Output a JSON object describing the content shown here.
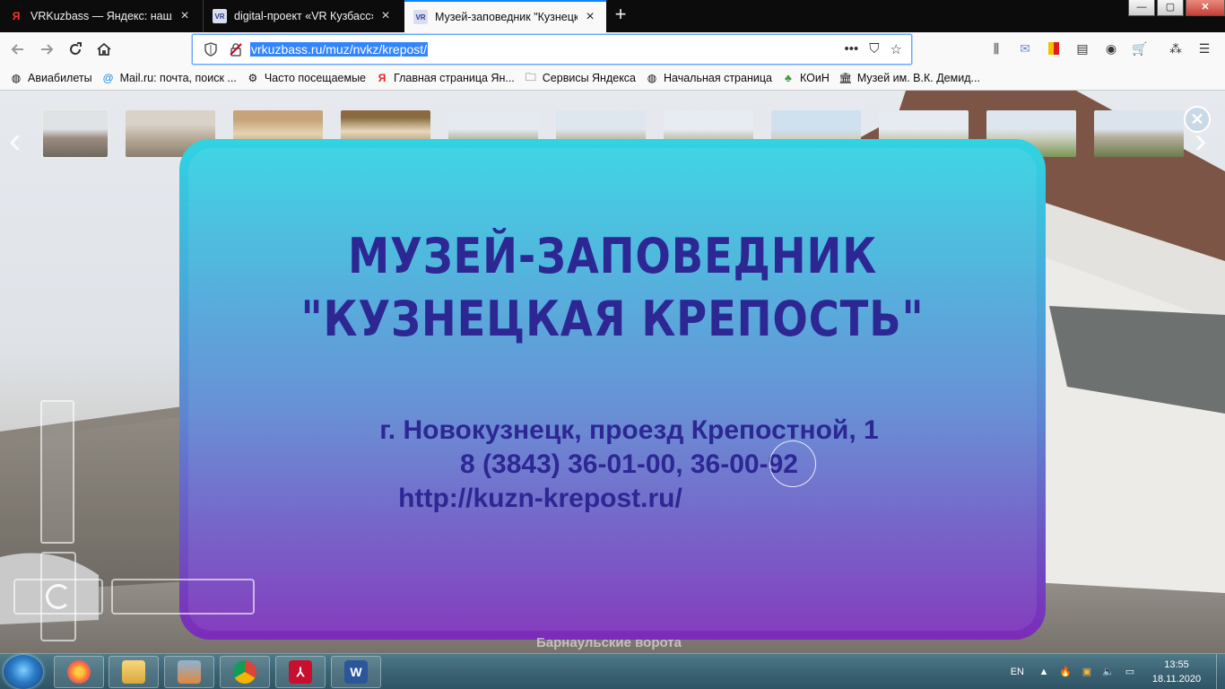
{
  "browser": {
    "tabs": [
      {
        "title": "VRKuzbass — Яндекс: нашлось",
        "favicon": "yandex-icon"
      },
      {
        "title": "digital-проект «VR Кузбасс» —",
        "favicon": "vr-kuzbass-icon"
      },
      {
        "title": "Музей-заповедник \"Кузнецка",
        "favicon": "vr-kuzbass-icon",
        "active": true
      }
    ],
    "new_tab": "+",
    "url": "vrkuzbass.ru/muz/nvkz/krepost/",
    "window_controls": {
      "minimize": "—",
      "maximize": "▢",
      "close": "✕"
    }
  },
  "bookmarks": [
    {
      "label": "Авиабилеты",
      "icon": "globe-icon"
    },
    {
      "label": "Mail.ru: почта, поиск ...",
      "icon": "mailru-icon"
    },
    {
      "label": "Часто посещаемые",
      "icon": "gear-icon"
    },
    {
      "label": "Главная страница Ян...",
      "icon": "yandex-icon"
    },
    {
      "label": "Сервисы Яндекса",
      "icon": "folder-icon"
    },
    {
      "label": "Начальная страница",
      "icon": "globe-icon"
    },
    {
      "label": "КОиН",
      "icon": "koin-icon"
    },
    {
      "label": "Музей им. В.К. Демид...",
      "icon": "museum-icon"
    }
  ],
  "pano": {
    "title_line1": "МУЗЕЙ-ЗАПОВЕДНИК",
    "title_line2": "\"КУЗНЕЦКАЯ КРЕПОСТЬ\"",
    "address": "г. Новокузнецк, проезд Крепостной, 1",
    "phone": "8 (3843) 36-01-00, 36-00-92",
    "website": "http://kuzn-krepost.ru/",
    "scene_label": "Барнаульские ворота",
    "thumbnail_count": 11,
    "colors": {
      "frame_top": "#2fd4e3",
      "frame_bottom": "#7b2bb8",
      "title": "#2d2793"
    }
  },
  "taskbar": {
    "apps": [
      "firefox-icon",
      "explorer-icon",
      "calculator-icon",
      "chrome-icon",
      "acrobat-icon",
      "word-icon"
    ],
    "lang": "EN",
    "time": "13:55",
    "date": "18.11.2020"
  }
}
